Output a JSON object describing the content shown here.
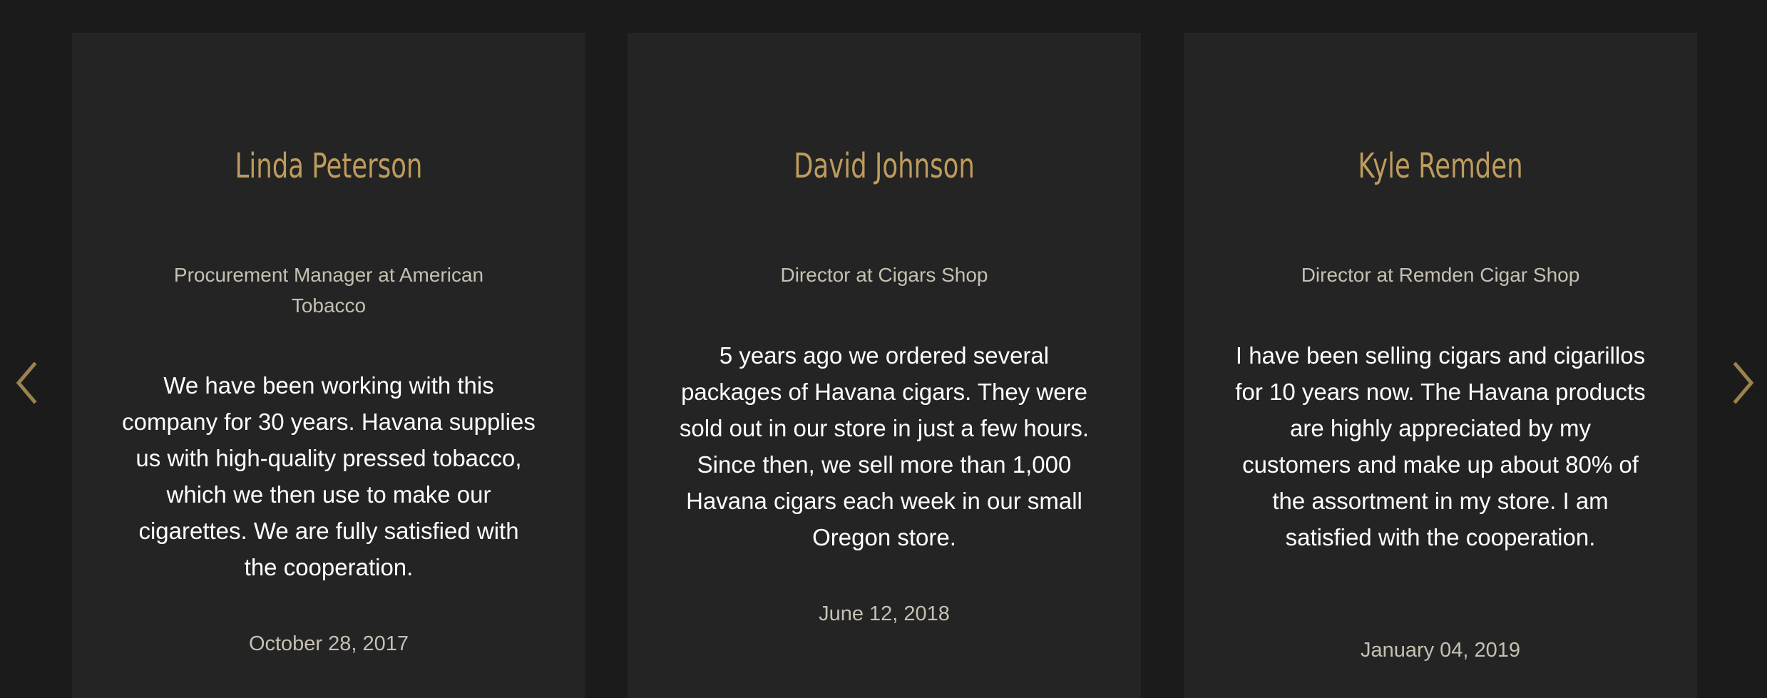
{
  "colors": {
    "background": "#1c1b1c",
    "card": "#242424",
    "accent_gold": "#bd9c5d",
    "muted_text": "#c5c0b2",
    "body_text": "#ffffff"
  },
  "navigation": {
    "prev_icon": "chevron-left-icon",
    "next_icon": "chevron-right-icon"
  },
  "testimonials": [
    {
      "name": "Linda Peterson",
      "position": "Procurement Manager at American Tobacco",
      "quote": "We have been working with this company for 30 years. Havana supplies us with high-quality pressed tobacco, which we then use to make our cigarettes. We are fully satisfied with the cooperation.",
      "date": "October 28, 2017"
    },
    {
      "name": "David Johnson",
      "position": "Director at Cigars Shop",
      "quote": "5 years ago we ordered several packages of Havana cigars. They were sold out in our store in just a few hours. Since then, we sell more than 1,000 Havana cigars each week in our small Oregon store.",
      "date": "June 12, 2018"
    },
    {
      "name": "Kyle Remden",
      "position": "Director at Remden Cigar Shop",
      "quote": "I have been selling cigars and cigarillos for 10 years now. The Havana products are highly appreciated by my customers and make up about 80% of the assortment in my store. I am satisfied with the cooperation.",
      "date": "January 04, 2019"
    }
  ]
}
